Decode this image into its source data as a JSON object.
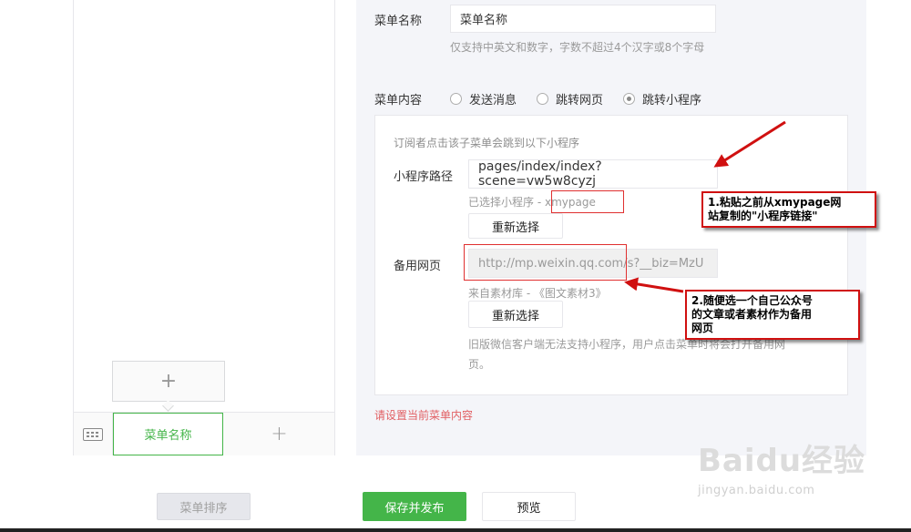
{
  "preview": {
    "menu_label": "菜单名称",
    "add_symbol": "+",
    "sub_add_symbol": "+"
  },
  "editor": {
    "name_label": "菜单名称",
    "name_value": "菜单名称",
    "name_tip": "仅支持中英文和数字，字数不超过4个汉字或8个字母",
    "content_label": "菜单内容",
    "radios": [
      {
        "label": "发送消息",
        "checked": false
      },
      {
        "label": "跳转网页",
        "checked": false
      },
      {
        "label": "跳转小程序",
        "checked": true
      }
    ],
    "mini": {
      "intro": "订阅者点击该子菜单会跳到以下小程序",
      "path_label": "小程序路径",
      "path_value": "pages/index/index?scene=vw5w8cyzj",
      "selected_prefix": "已选择小程序 - ",
      "selected_name": "xmypage",
      "reselect_label": "重新选择",
      "backup_label": "备用网页",
      "backup_value": "http://mp.weixin.qq.com/s?__biz=MzU",
      "source_text": "来自素材库 - 《图文素材3》",
      "reselect_label_2": "重新选择",
      "old_client_tip_1": "旧版微信客户端无法支持小程序，用户点击菜单时将会打开备用网",
      "old_client_tip_2": "页。"
    },
    "error_text": "请设置当前菜单内容"
  },
  "footer": {
    "sort_label": "菜单排序",
    "save_label": "保存并发布",
    "preview_label": "预览"
  },
  "annotations": {
    "callout_1_line1": "1.粘贴之前从xmypage网",
    "callout_1_line2": "站复制的\"小程序链接\"",
    "callout_2_line1": "2.随便选一个自己公众号",
    "callout_2_line2": "的文章或者素材作为备用",
    "callout_2_line3": "网页"
  },
  "watermark": {
    "logo": "Baidu经验",
    "url": "jingyan.baidu.com"
  },
  "colors": {
    "accent_green": "#44b549",
    "error_red": "#e15f63",
    "annotation_red": "#d01010"
  }
}
